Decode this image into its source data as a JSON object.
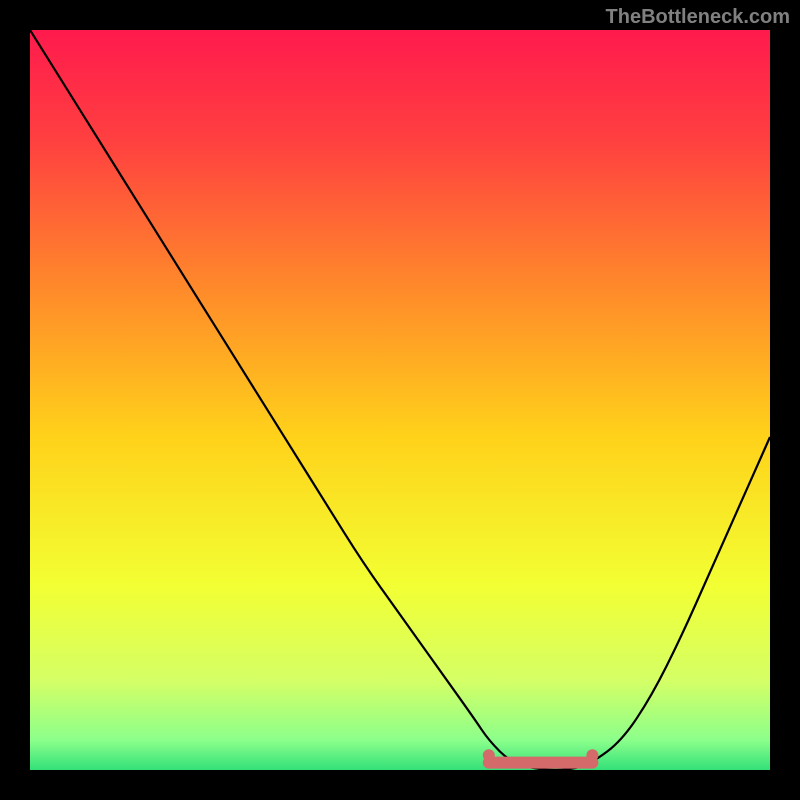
{
  "watermark": "TheBottleneck.com",
  "chart_data": {
    "type": "line",
    "title": "",
    "xlabel": "",
    "ylabel": "",
    "xlim": [
      0,
      100
    ],
    "ylim": [
      0,
      100
    ],
    "grid": false,
    "legend": false,
    "background": {
      "type": "vertical-gradient",
      "stops": [
        {
          "pos": 0.0,
          "color": "#ff1a4d"
        },
        {
          "pos": 0.15,
          "color": "#ff4040"
        },
        {
          "pos": 0.35,
          "color": "#ff8a2a"
        },
        {
          "pos": 0.55,
          "color": "#ffd21a"
        },
        {
          "pos": 0.75,
          "color": "#f2ff33"
        },
        {
          "pos": 0.88,
          "color": "#d4ff66"
        },
        {
          "pos": 0.96,
          "color": "#8bff8b"
        },
        {
          "pos": 1.0,
          "color": "#33e079"
        }
      ]
    },
    "series": [
      {
        "name": "bottleneck-curve",
        "color": "#000000",
        "x": [
          0,
          5,
          10,
          15,
          20,
          25,
          30,
          35,
          40,
          45,
          50,
          55,
          60,
          62,
          65,
          69,
          73,
          76,
          80,
          84,
          88,
          92,
          96,
          100
        ],
        "values": [
          100,
          92,
          84,
          76,
          68,
          60,
          52,
          44,
          36,
          28,
          21,
          14,
          7,
          4,
          1,
          0,
          0,
          1,
          4,
          10,
          18,
          27,
          36,
          45
        ]
      },
      {
        "name": "optimal-range-band",
        "type": "segment",
        "color": "#d46a6a",
        "thickness": 12,
        "x": [
          62,
          76
        ],
        "values": [
          1,
          1
        ]
      }
    ],
    "markers": [
      {
        "name": "optimal-start-dot",
        "x": 62,
        "y": 2,
        "r": 6,
        "color": "#d46a6a"
      },
      {
        "name": "optimal-end-dot",
        "x": 76,
        "y": 2,
        "r": 6,
        "color": "#d46a6a"
      }
    ]
  }
}
